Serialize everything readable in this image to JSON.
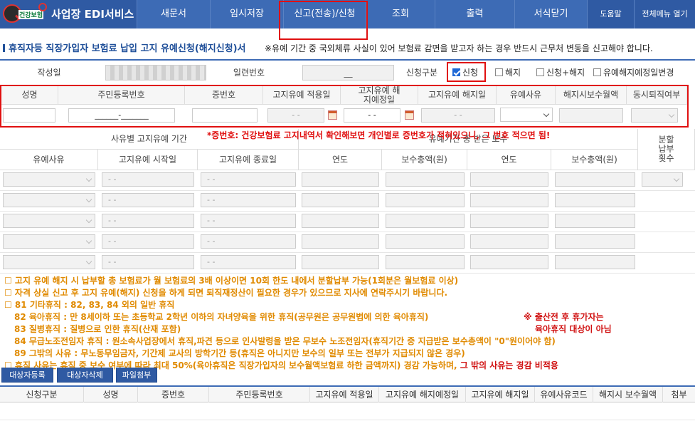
{
  "app": {
    "title": "사업장 EDI서비스",
    "logo_text": "건강보험"
  },
  "nav": [
    {
      "label": "새문서"
    },
    {
      "label": "임시저장"
    },
    {
      "label": "신고(전송)/신청"
    },
    {
      "label": "조회"
    },
    {
      "label": "출력"
    },
    {
      "label": "서식닫기"
    },
    {
      "label": "도움말"
    },
    {
      "label": "전체메뉴 열기"
    }
  ],
  "doc": {
    "title": "휴직자등 직장가입자 보험료 납입 고지 유예신청(해지신청)서",
    "note": "※유예 기간 중 국외체류 사실이 있어 보험료 감면을 받고자 하는 경우 반드시 근무처 변동을 신고해야 합니다."
  },
  "info": {
    "written_date_label": "작성일",
    "serial_label": "일련번호",
    "serial_value": "__",
    "request_type_label": "신청구분",
    "options": [
      {
        "label": "신청",
        "checked": true
      },
      {
        "label": "해지",
        "checked": false
      },
      {
        "label": "신청+해지",
        "checked": false
      },
      {
        "label": "유예해지예정일변경",
        "checked": false
      }
    ]
  },
  "main_table": {
    "headers": [
      "성명",
      "주민등록번호",
      "증번호",
      "고지유예 적용일",
      "고지유예 해지예정일",
      "고지유예 해지일",
      "유예사유",
      "해지시보수월액",
      "동시퇴직여부"
    ],
    "rrn_value": "______-_______",
    "date_placeholder": "- -"
  },
  "annotation": "*증번호: 건강보험료 고지내역서 확인해보면 개인별로 증번호가 적혀있으니, 그 번호 적으면 됨!",
  "period_table": {
    "group1": "사유별 고지유예 기간",
    "group2": "유예기간 중 받은 보수",
    "headers": [
      "유예사유",
      "고지유예 시작일",
      "고지유예 종료일",
      "연도",
      "보수총액(원)",
      "연도",
      "보수총액(원)",
      "분할 납부 횟수"
    ],
    "date_placeholder": "- -",
    "row_count": 5
  },
  "notes": {
    "line1": "☐ 고지 유예 해지 시 납부할 총 보험료가 월 보험료의 3배 이상이면 10회 한도 내에서 분할납부 가능(1회분은 월보험료 이상)",
    "line2": "☐ 자격 상실 신고 후 고지 유예(해지) 신청을 하게 되면 퇴직재정산이 필요한 경우가 있으므로 지사에 연락주시기 바랍니다.",
    "line3": "☐ 81 기타휴직 : 82, 83, 84 외의 일반 휴직",
    "line4": "82 육아휴직 : 만 8세이하 또는 초등학교 2학년 이하의 자녀양육을 위한 휴직(공무원은 공무원법에 의한 육아휴직)",
    "line4b": "※ 출산전 후 휴가자는",
    "line5": "83 질병휴직 : 질병으로 인한 휴직(산재 포함)",
    "line5b": "육아휴직 대상이 아님",
    "line6": "84 무급노조전임자 휴직 : 원소속사업장에서 휴직,파견 등으로 인사발령을 받은 무보수 노조전임자(휴직기간 중 지급받은 보수총액이 \"0\"원이어야 함)",
    "line7": "89 그밖의 사유 : 무노동무임금자, 기간제 교사의 방학기간 등(휴직은 아니지만 보수의 일부 또는 전부가 지급되지 않은 경우)",
    "line8": "☐ 휴직 사유는 휴직 중 보수 여부에 따라 최대 50%(육아휴직은 직장가입자의 보수월액보험료 하한 금액까지) 경감 가능하며,",
    "line8b": "그 밖의 사유는 경감 비적용"
  },
  "buttons": {
    "register": "대상자등록",
    "delete": "대상자삭제",
    "attach": "파일첨부"
  },
  "bottom_headers": [
    "신청구분",
    "성명",
    "증번호",
    "주민등록번호",
    "고지유예 적용일",
    "고지유예 해지예정일",
    "고지유예 해지일",
    "유예사유코드",
    "해지시 보수월액",
    "첨부"
  ],
  "colors": {
    "nav": "#3d6bb5",
    "highlight": "#e01010",
    "note": "#e08a00"
  }
}
